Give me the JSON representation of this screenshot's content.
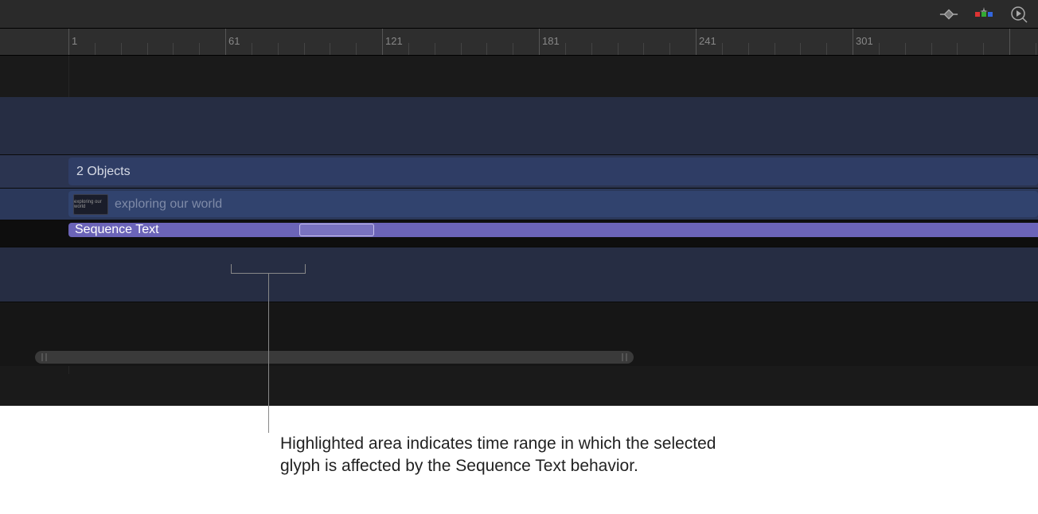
{
  "ruler": {
    "major_ticks": [
      {
        "pos": 86,
        "label": "1"
      },
      {
        "pos": 283,
        "label": "61"
      },
      {
        "pos": 480,
        "label": "121"
      },
      {
        "pos": 677,
        "label": "181"
      },
      {
        "pos": 874,
        "label": "241"
      },
      {
        "pos": 1071,
        "label": "301"
      }
    ]
  },
  "tracks": {
    "objects_label": "2 Objects",
    "text_layer_label": "exploring our world",
    "behavior_label": "Sequence Text",
    "thumb_text": "exploring our world"
  },
  "caption": "Highlighted area indicates time range in which the selected glyph is affected by the Sequence Text behavior.",
  "icons": {
    "keyframe": "keyframe-icon",
    "filters": "filters-sparkle-icon",
    "search": "search-play-icon"
  }
}
